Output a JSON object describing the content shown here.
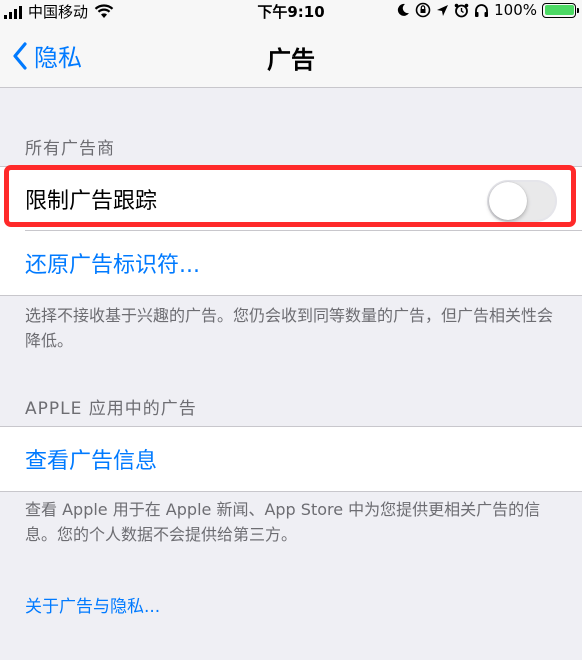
{
  "status_bar": {
    "carrier": "中国移动",
    "time": "下午9:10",
    "battery": "100%"
  },
  "nav": {
    "back_label": "隐私",
    "title": "广告"
  },
  "sections": {
    "all_advertisers_header": "所有广告商",
    "limit_ad_tracking_label": "限制广告跟踪",
    "reset_identifier_label": "还原广告标识符...",
    "all_advertisers_footer": "选择不接收基于兴趣的广告。您仍会收到同等数量的广告，但广告相关性会降低。",
    "apple_apps_header": "APPLE 应用中的广告",
    "view_ad_info_label": "查看广告信息",
    "apple_apps_footer": "查看 Apple 用于在 Apple 新闻、App Store 中为您提供更相关广告的信息。您的个人数据不会提供给第三方。",
    "about_link": "关于广告与隐私..."
  },
  "toggle": {
    "state": "off"
  },
  "colors": {
    "accent": "#007aff",
    "highlight": "#ff2a2a",
    "battery": "#4cd964",
    "background": "#efeff4"
  }
}
